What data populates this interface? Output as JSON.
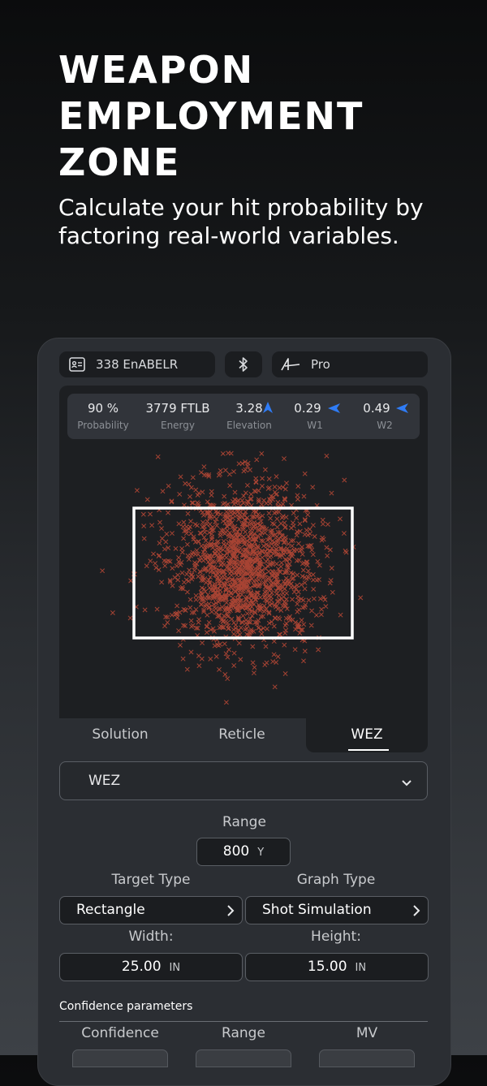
{
  "hero": {
    "headline_lines": [
      "WEAPON",
      "EMPLOYMENT",
      "ZONE"
    ],
    "subtitle": "Calculate your hit probability by factoring real-world variables."
  },
  "device": {
    "profile_chip": {
      "icon": "id-card-icon",
      "label": "338 EnABELR"
    },
    "bluetooth_chip": {
      "icon": "bluetooth-icon"
    },
    "brand_chip": {
      "icon": "brand-logo-icon",
      "label": "Pro"
    },
    "stats": [
      {
        "value": "90 %",
        "label": "Probability"
      },
      {
        "value": "3779 FTLB",
        "label": "Energy"
      },
      {
        "value": "3.28",
        "label": "Elevation",
        "arrow": "up-arrow-icon"
      },
      {
        "value": "0.29",
        "label": "W1",
        "arrow": "left-arrow-icon"
      },
      {
        "value": "0.49",
        "label": "W2",
        "arrow": "left-arrow-icon"
      }
    ],
    "colors": {
      "accent": "#2f7cf6",
      "shot_marks": "#d6503a",
      "target_frame": "#ffffff"
    },
    "tabs": [
      {
        "label": "Solution",
        "active": false
      },
      {
        "label": "Reticle",
        "active": false
      },
      {
        "label": "WEZ",
        "active": true
      }
    ],
    "mode_select": {
      "value": "WEZ"
    },
    "range": {
      "label": "Range",
      "value": "800",
      "unit": "Y"
    },
    "target_type": {
      "label": "Target Type",
      "value": "Rectangle"
    },
    "graph_type": {
      "label": "Graph Type",
      "value": "Shot Simulation"
    },
    "width": {
      "label": "Width:",
      "value": "25.00",
      "unit": "IN"
    },
    "height": {
      "label": "Height:",
      "value": "15.00",
      "unit": "IN"
    },
    "confidence_section": {
      "title": "Confidence parameters",
      "columns": [
        "Confidence",
        "Range",
        "MV"
      ]
    }
  }
}
